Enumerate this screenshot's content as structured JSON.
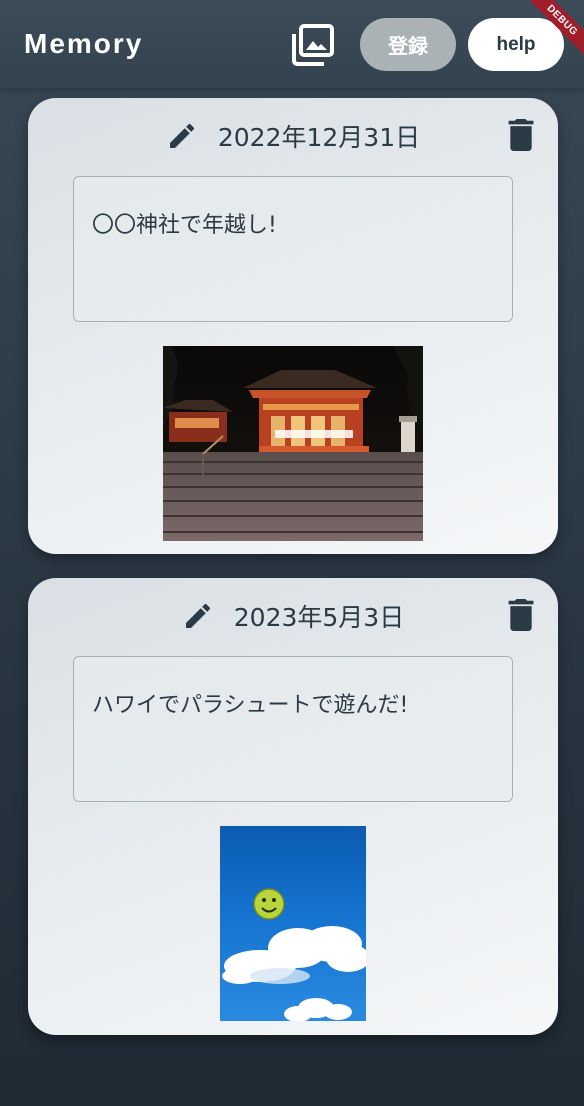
{
  "app": {
    "title": "Memory",
    "register_label": "登録",
    "help_label": "help",
    "debug_banner": "DEBUG"
  },
  "colors": {
    "appbar": "#33424f",
    "card": "#e8ecef",
    "text": "#2b3a47",
    "register_button": "#aab2b6"
  },
  "icons": {
    "gallery": "photo-library-icon",
    "edit": "pencil-icon",
    "delete": "trash-icon"
  },
  "memories": [
    {
      "date": "2022年12月31日",
      "text": "〇〇神社で年越し!",
      "photo": "shrine-at-night"
    },
    {
      "date": "2023年5月3日",
      "text": "ハワイでパラシュートで遊んだ!",
      "photo": "parachute-in-blue-sky"
    }
  ]
}
